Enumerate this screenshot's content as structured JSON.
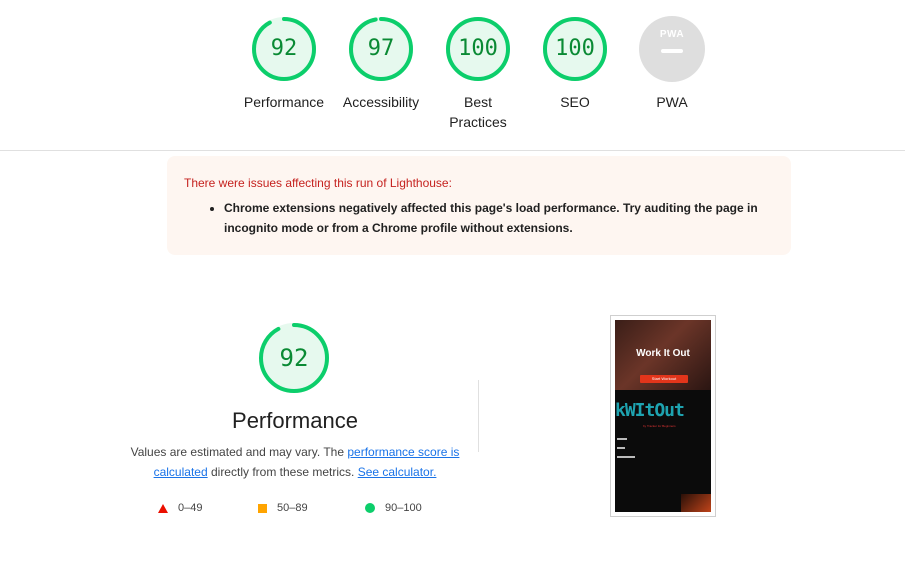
{
  "categories": [
    {
      "label": "Performance",
      "score": "92",
      "value": 92
    },
    {
      "label": "Accessibility",
      "score": "97",
      "value": 97
    },
    {
      "label": "Best Practices",
      "score": "100",
      "value": 100
    },
    {
      "label": "SEO",
      "score": "100",
      "value": 100
    },
    {
      "label": "PWA",
      "score": "PWA",
      "value": null
    }
  ],
  "warning": {
    "title": "There were issues affecting this run of Lighthouse:",
    "items": [
      "Chrome extensions negatively affected this page's load performance. Try auditing the page in incognito mode or from a Chrome profile without extensions."
    ]
  },
  "performance": {
    "score": "92",
    "value": 92,
    "title": "Performance",
    "desc_pre": "Values are estimated and may vary. The ",
    "desc_link1": "performance score is calculated",
    "desc_mid": " directly from these metrics. ",
    "desc_link2": "See calculator."
  },
  "legend": {
    "fail": "0–49",
    "average": "50–89",
    "pass": "90–100"
  },
  "screenshot": {
    "headline": "Work It Out",
    "button": "Start Workout",
    "logo": "kWItOut",
    "subtitle": "by Tracker for Beginners"
  },
  "colors": {
    "pass": "#0cce6b",
    "pass_text": "#0a8a34",
    "pass_fill": "#e6f9ee",
    "average": "#ffa400",
    "fail": "#eb0f00",
    "pwa_gray": "#dedede",
    "warning_bg": "#fef6f1",
    "warning_title": "#c5221f",
    "link": "#1a73e8"
  }
}
